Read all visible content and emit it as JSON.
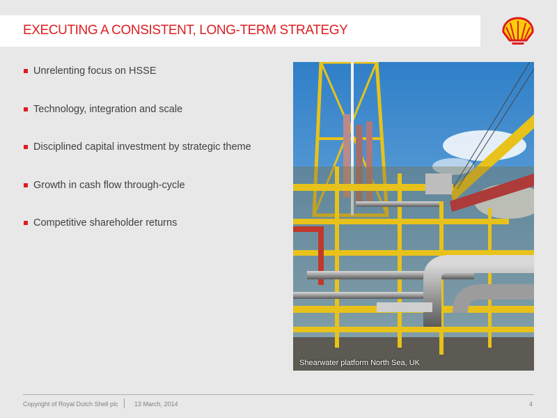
{
  "header": {
    "title": "EXECUTING A CONSISTENT, LONG-TERM STRATEGY"
  },
  "bullets": [
    "Unrelenting focus on HSSE",
    "Technology, integration and scale",
    "Disciplined capital investment by strategic theme",
    "Growth in cash flow through-cycle",
    "Competitive shareholder returns"
  ],
  "photo": {
    "caption": "Shearwater platform North Sea, UK"
  },
  "footer": {
    "copyright": "Copyright of Royal Dutch Shell plc",
    "date": "13 March, 2014",
    "page_number": "4"
  },
  "colors": {
    "accent": "#dd1d21",
    "logo_yellow": "#fbce07",
    "background": "#e8e8e9"
  },
  "icons": {
    "logo": "shell-pecten-logo-icon"
  }
}
